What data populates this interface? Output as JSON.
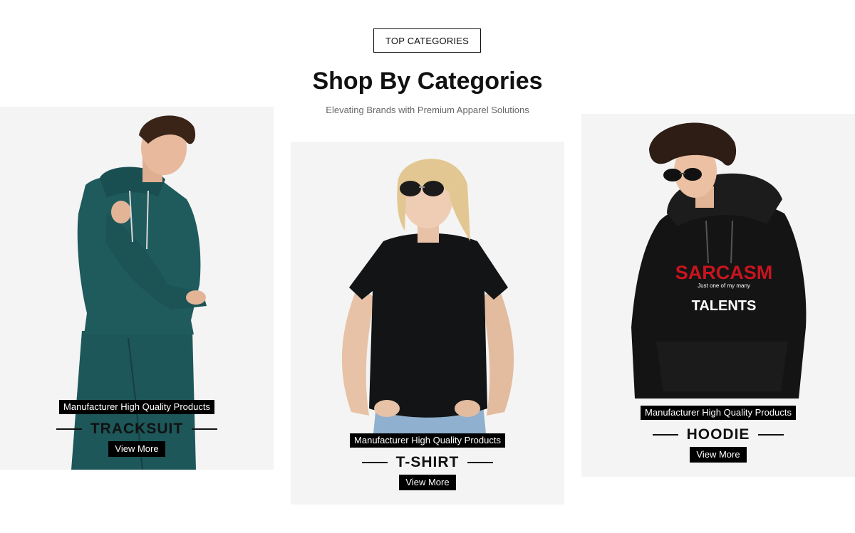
{
  "header": {
    "badge_label": "TOP CATEGORIES",
    "title": "Shop By Categories",
    "subtitle": "Elevating Brands with Premium Apparel Solutions"
  },
  "categories": [
    {
      "tag": "Manufacturer High Quality Products",
      "name": "TRACKSUIT",
      "button": "View More",
      "garment_color": "#1f5a5c"
    },
    {
      "tag": "Manufacturer High Quality Products",
      "name": "T-SHIRT",
      "button": "View More",
      "garment_color": "#121416"
    },
    {
      "tag": "Manufacturer High Quality Products",
      "name": "HOODIE",
      "button": "View More",
      "garment_color": "#141414",
      "print_lines": [
        "SARCASM",
        "Just one of my many",
        "TALENTS"
      ]
    }
  ],
  "colors": {
    "card_bg": "#f4f4f4",
    "accent": "#000000",
    "print_red": "#c8141e"
  }
}
